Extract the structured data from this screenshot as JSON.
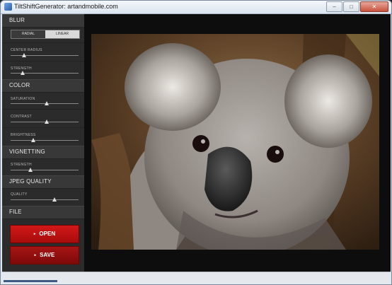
{
  "window": {
    "title": "TiltShiftGenerator: artandmobile.com",
    "minimize_glyph": "–",
    "maximize_glyph": "□",
    "close_glyph": "✕"
  },
  "sidebar": {
    "blur": {
      "heading": "BLUR",
      "mode_options": [
        "RADIAL",
        "LINEAR"
      ],
      "selected_mode": "LINEAR",
      "center_radius_label": "CENTER RADIUS",
      "center_radius_value": 0.2,
      "strength_label": "STRENGTH",
      "strength_value": 0.18
    },
    "color": {
      "heading": "COLOR",
      "saturation_label": "SATURATION",
      "saturation_value": 0.53,
      "contrast_label": "CONTRAST",
      "contrast_value": 0.53,
      "brightness_label": "BRIGHTNESS",
      "brightness_value": 0.33
    },
    "vignetting": {
      "heading": "VIGNETTING",
      "strength_label": "STRENGTH",
      "strength_value": 0.29
    },
    "jpeg": {
      "heading": "JPEG QUALITY",
      "quality_label": "QUALITY",
      "quality_value": 0.65
    },
    "file": {
      "heading": "FILE",
      "open_label": "OPEN",
      "save_label": "SAVE",
      "button_arrow": "▸"
    }
  },
  "colors": {
    "accent_red": "#c81212",
    "panel_bg": "#2b2b2b",
    "section_bg": "#383838"
  },
  "photo": {
    "subject": "koala"
  }
}
